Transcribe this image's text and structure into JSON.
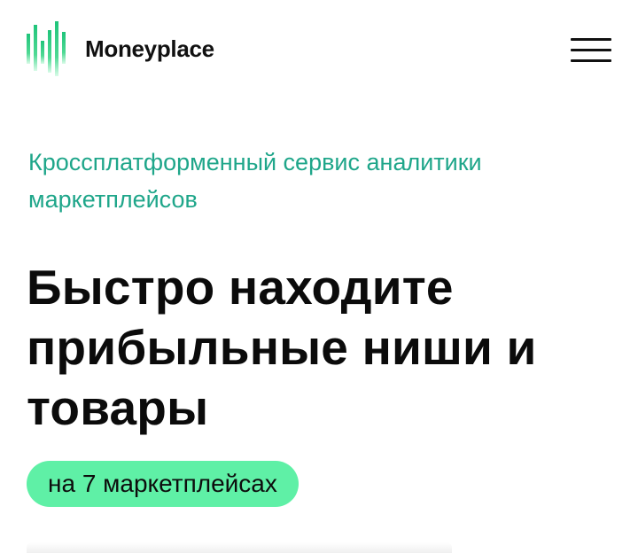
{
  "header": {
    "brand_name": "Moneyplace",
    "logo_icon": "bar-chart-logo-icon",
    "menu_icon": "hamburger-menu-icon"
  },
  "hero": {
    "eyebrow": "Кроссплатформенный сервис аналитики маркетплейсов",
    "headline": "Быстро находите прибыльные ниши и товары",
    "badge": "на 7 маркетплейсах"
  },
  "colors": {
    "accent_text": "#1fa68a",
    "badge_background": "#5ff0a6",
    "logo_gradient_top": "#1fc47a",
    "logo_gradient_bottom": "#b7f5d2",
    "text": "#0b0b0b"
  }
}
